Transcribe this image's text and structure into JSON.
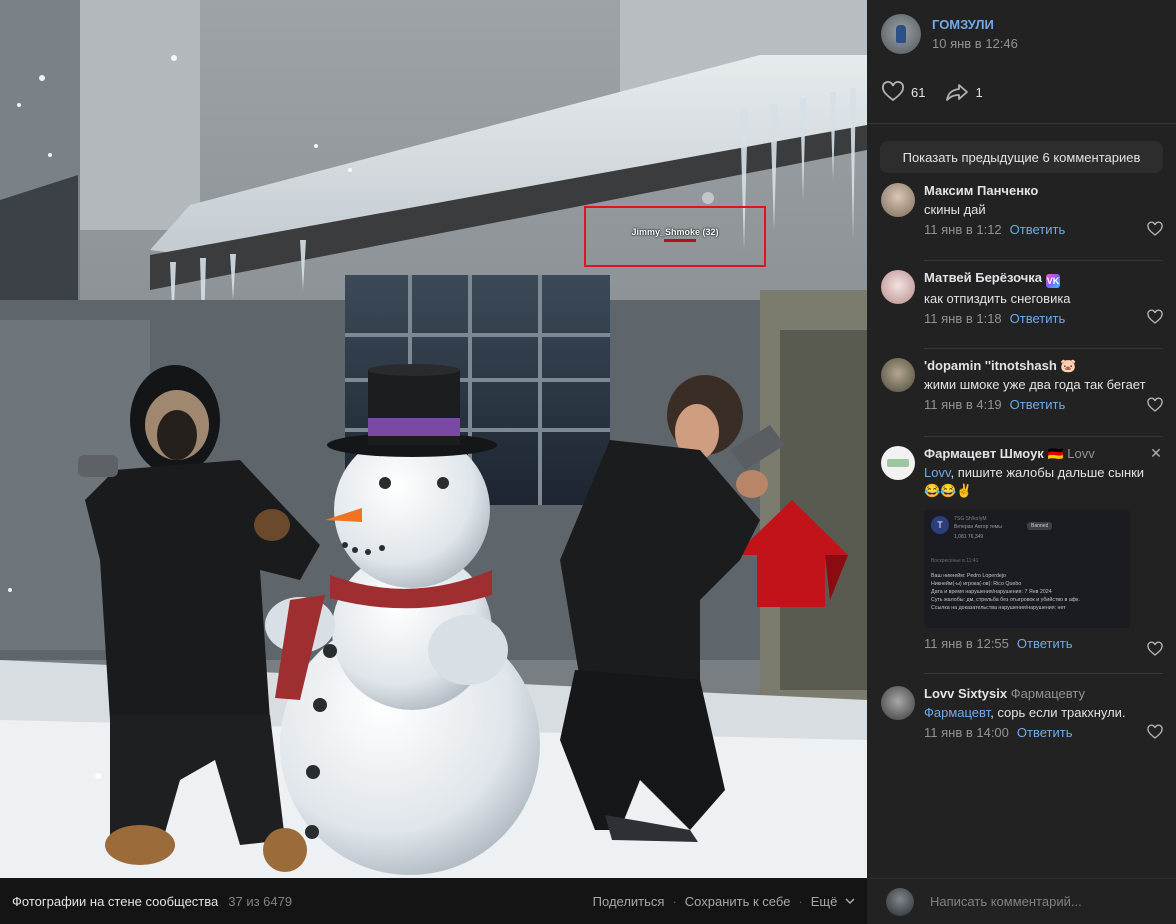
{
  "photo": {
    "nametag": "Jimmy_Shmoke (32)"
  },
  "photo_bar": {
    "album_title": "Фотографии на стене сообщества",
    "counter": "37 из 6479",
    "share_label": "Поделиться",
    "save_label": "Сохранить к себе",
    "more_label": "Ещё",
    "separator": "·"
  },
  "post": {
    "group_name": "ГОМЗУЛИ",
    "date": "10 янв в 12:46",
    "likes": "61",
    "shares": "1"
  },
  "comments_panel": {
    "show_previous_label": "Показать предыдущие 6 комментариев",
    "reply_label": "Ответить",
    "comments": [
      {
        "author": "Максим Панченко",
        "text": "скины дай",
        "time": "11 янв в 1:12"
      },
      {
        "author": "Матвей Берёзочка",
        "badge": "VK",
        "text": "как отпиздить снеговика",
        "time": "11 янв в 1:18"
      },
      {
        "author": "'dopamin ''itnotshash",
        "badge_emoji": "🐷",
        "text": "жими шмоке уже два года так бегает",
        "time": "11 янв в 4:19"
      },
      {
        "author": "Фармацевт Шмоук",
        "badge_emoji": "🇩🇪",
        "reply_to": "Lovv",
        "mention": "Lovv",
        "text": ", пишите жалобы дальше сынки",
        "emoji": "😂😂✌️",
        "time": "11 янв в 12:55",
        "close": "✕",
        "attachment": {
          "avatar_letter": "T",
          "username": "TSG Sh!ko!yM",
          "role": "Ветеран    Автор темы",
          "status": "Banned",
          "stats": "1,081   76,349",
          "date": "Воскресенье в 11:41",
          "lines": [
            "Ваш никнейм: Pedro Loperdejo",
            "Никнейм(-ы) игрока(-ов): Rico Quebo",
            "Дата и время нарушения/нарушения: 7 Янв 2024",
            "Суть жалобы: дм, стрельба без отыгровок и убийство в афк.",
            "Ссылка на доказательства нарушения/нарушения: нет"
          ]
        }
      },
      {
        "author": "Lovv Sixtysix",
        "reply_to": "Фармацевту",
        "mention": "Фармацевт",
        "text": ", сорь если тракхнули.",
        "time": "11 янв в 14:00"
      }
    ],
    "input_placeholder": "Написать комментарий..."
  },
  "colors": {
    "accent": "#71aaeb",
    "panel_bg": "#222222",
    "page_bg": "#141414",
    "highlight_box": "#e0141e"
  }
}
